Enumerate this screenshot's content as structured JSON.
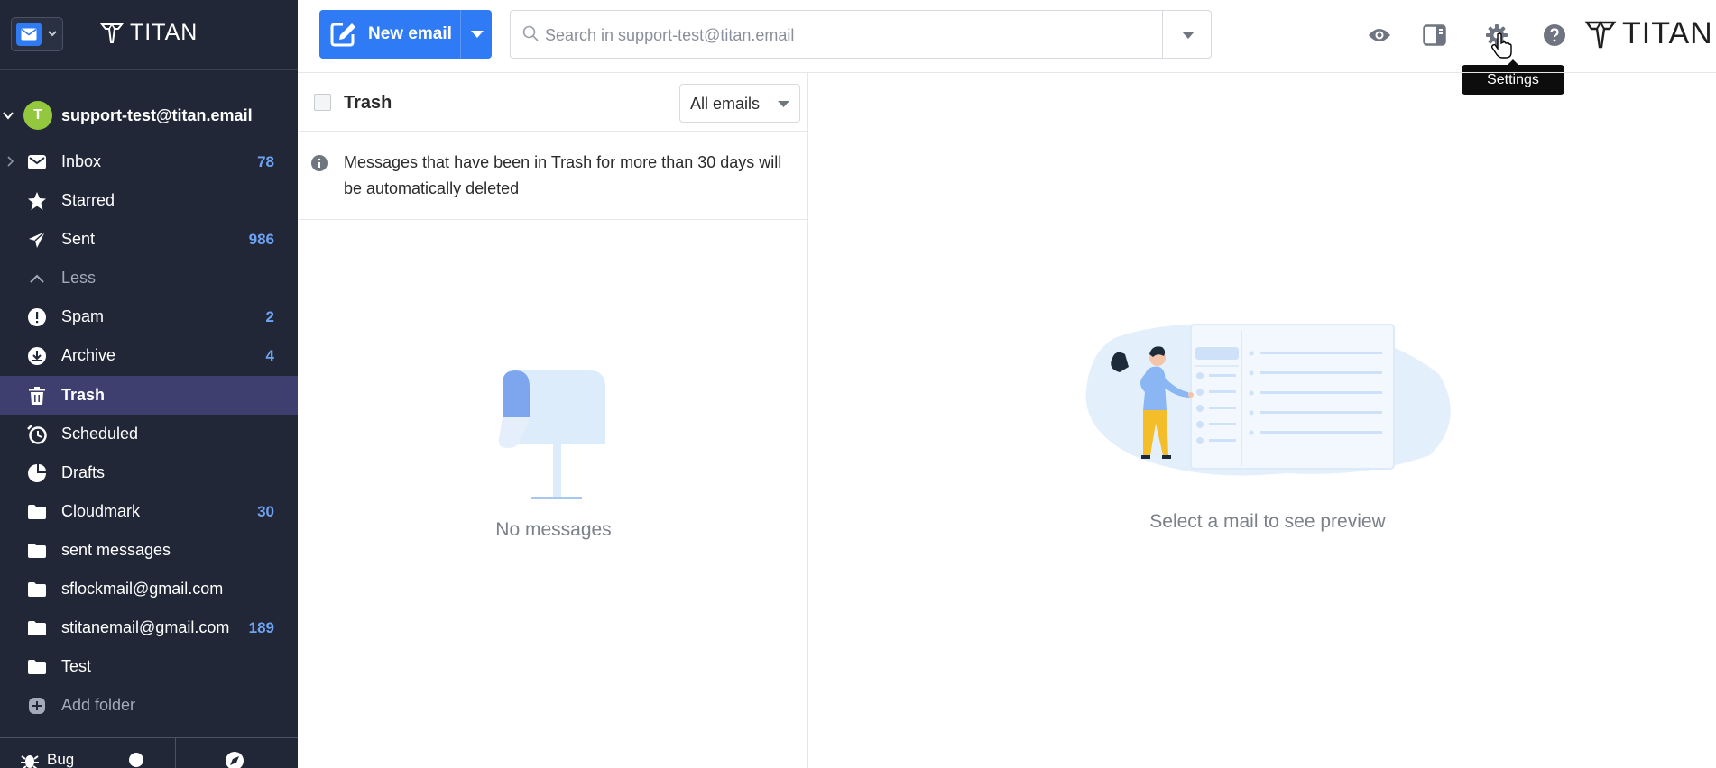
{
  "brand": {
    "name": "TITAN"
  },
  "account": {
    "initial": "T",
    "email": "support-test@titan.email"
  },
  "folders": [
    {
      "label": "Inbox",
      "count": "78",
      "icon": "envelope-icon"
    },
    {
      "label": "Starred",
      "count": "",
      "icon": "star-icon"
    },
    {
      "label": "Sent",
      "count": "986",
      "icon": "paper-plane-icon"
    },
    {
      "label": "Less",
      "count": "",
      "icon": "chevron-up-icon"
    },
    {
      "label": "Spam",
      "count": "2",
      "icon": "alert-icon"
    },
    {
      "label": "Archive",
      "count": "4",
      "icon": "archive-icon"
    },
    {
      "label": "Trash",
      "count": "",
      "icon": "trash-icon"
    },
    {
      "label": "Scheduled",
      "count": "",
      "icon": "clock-icon"
    },
    {
      "label": "Drafts",
      "count": "",
      "icon": "drafts-icon"
    },
    {
      "label": "Cloudmark",
      "count": "30",
      "icon": "folder-icon"
    },
    {
      "label": "sent messages",
      "count": "",
      "icon": "folder-icon"
    },
    {
      "label": "sflockmail@gmail.com",
      "count": "",
      "icon": "folder-icon"
    },
    {
      "label": "stitanemail@gmail.com",
      "count": "189",
      "icon": "folder-icon"
    },
    {
      "label": "Test",
      "count": "",
      "icon": "folder-icon"
    },
    {
      "label": "Add folder",
      "count": "",
      "icon": "plus-circle-icon"
    }
  ],
  "sidebar_bottom": {
    "bug_label": "Bug"
  },
  "toolbar": {
    "new_email_label": "New email",
    "search_placeholder": "Search in support-test@titan.email",
    "settings_tooltip": "Settings"
  },
  "list": {
    "title": "Trash",
    "filter_value": "All emails",
    "trash_note": "Messages that have been in Trash for more than 30 days will be automatically deleted",
    "empty_text": "No messages"
  },
  "preview": {
    "empty_text": "Select a mail to see preview"
  },
  "colors": {
    "sidebar_bg": "#212736",
    "active_folder_bg": "#3e3f6e",
    "accent": "#2f7bf5",
    "count": "#6ea4f5"
  }
}
